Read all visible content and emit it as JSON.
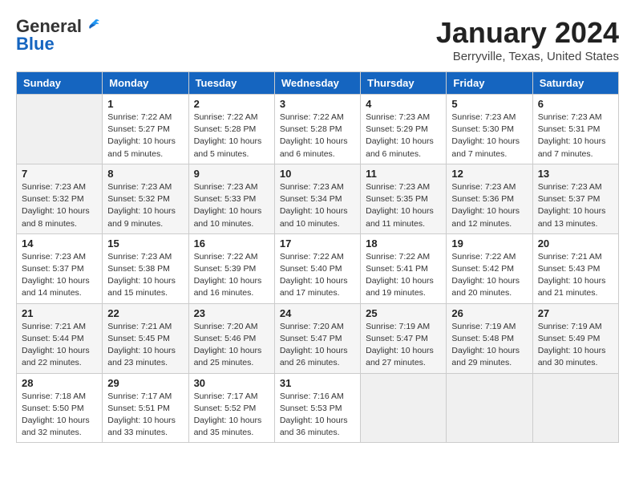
{
  "header": {
    "logo_line1": "General",
    "logo_line2": "Blue",
    "title": "January 2024",
    "subtitle": "Berryville, Texas, United States"
  },
  "weekdays": [
    "Sunday",
    "Monday",
    "Tuesday",
    "Wednesday",
    "Thursday",
    "Friday",
    "Saturday"
  ],
  "weeks": [
    [
      {
        "day": "",
        "info": ""
      },
      {
        "day": "1",
        "info": "Sunrise: 7:22 AM\nSunset: 5:27 PM\nDaylight: 10 hours\nand 5 minutes."
      },
      {
        "day": "2",
        "info": "Sunrise: 7:22 AM\nSunset: 5:28 PM\nDaylight: 10 hours\nand 5 minutes."
      },
      {
        "day": "3",
        "info": "Sunrise: 7:22 AM\nSunset: 5:28 PM\nDaylight: 10 hours\nand 6 minutes."
      },
      {
        "day": "4",
        "info": "Sunrise: 7:23 AM\nSunset: 5:29 PM\nDaylight: 10 hours\nand 6 minutes."
      },
      {
        "day": "5",
        "info": "Sunrise: 7:23 AM\nSunset: 5:30 PM\nDaylight: 10 hours\nand 7 minutes."
      },
      {
        "day": "6",
        "info": "Sunrise: 7:23 AM\nSunset: 5:31 PM\nDaylight: 10 hours\nand 7 minutes."
      }
    ],
    [
      {
        "day": "7",
        "info": "Sunrise: 7:23 AM\nSunset: 5:32 PM\nDaylight: 10 hours\nand 8 minutes."
      },
      {
        "day": "8",
        "info": "Sunrise: 7:23 AM\nSunset: 5:32 PM\nDaylight: 10 hours\nand 9 minutes."
      },
      {
        "day": "9",
        "info": "Sunrise: 7:23 AM\nSunset: 5:33 PM\nDaylight: 10 hours\nand 10 minutes."
      },
      {
        "day": "10",
        "info": "Sunrise: 7:23 AM\nSunset: 5:34 PM\nDaylight: 10 hours\nand 10 minutes."
      },
      {
        "day": "11",
        "info": "Sunrise: 7:23 AM\nSunset: 5:35 PM\nDaylight: 10 hours\nand 11 minutes."
      },
      {
        "day": "12",
        "info": "Sunrise: 7:23 AM\nSunset: 5:36 PM\nDaylight: 10 hours\nand 12 minutes."
      },
      {
        "day": "13",
        "info": "Sunrise: 7:23 AM\nSunset: 5:37 PM\nDaylight: 10 hours\nand 13 minutes."
      }
    ],
    [
      {
        "day": "14",
        "info": "Sunrise: 7:23 AM\nSunset: 5:37 PM\nDaylight: 10 hours\nand 14 minutes."
      },
      {
        "day": "15",
        "info": "Sunrise: 7:23 AM\nSunset: 5:38 PM\nDaylight: 10 hours\nand 15 minutes."
      },
      {
        "day": "16",
        "info": "Sunrise: 7:22 AM\nSunset: 5:39 PM\nDaylight: 10 hours\nand 16 minutes."
      },
      {
        "day": "17",
        "info": "Sunrise: 7:22 AM\nSunset: 5:40 PM\nDaylight: 10 hours\nand 17 minutes."
      },
      {
        "day": "18",
        "info": "Sunrise: 7:22 AM\nSunset: 5:41 PM\nDaylight: 10 hours\nand 19 minutes."
      },
      {
        "day": "19",
        "info": "Sunrise: 7:22 AM\nSunset: 5:42 PM\nDaylight: 10 hours\nand 20 minutes."
      },
      {
        "day": "20",
        "info": "Sunrise: 7:21 AM\nSunset: 5:43 PM\nDaylight: 10 hours\nand 21 minutes."
      }
    ],
    [
      {
        "day": "21",
        "info": "Sunrise: 7:21 AM\nSunset: 5:44 PM\nDaylight: 10 hours\nand 22 minutes."
      },
      {
        "day": "22",
        "info": "Sunrise: 7:21 AM\nSunset: 5:45 PM\nDaylight: 10 hours\nand 23 minutes."
      },
      {
        "day": "23",
        "info": "Sunrise: 7:20 AM\nSunset: 5:46 PM\nDaylight: 10 hours\nand 25 minutes."
      },
      {
        "day": "24",
        "info": "Sunrise: 7:20 AM\nSunset: 5:47 PM\nDaylight: 10 hours\nand 26 minutes."
      },
      {
        "day": "25",
        "info": "Sunrise: 7:19 AM\nSunset: 5:47 PM\nDaylight: 10 hours\nand 27 minutes."
      },
      {
        "day": "26",
        "info": "Sunrise: 7:19 AM\nSunset: 5:48 PM\nDaylight: 10 hours\nand 29 minutes."
      },
      {
        "day": "27",
        "info": "Sunrise: 7:19 AM\nSunset: 5:49 PM\nDaylight: 10 hours\nand 30 minutes."
      }
    ],
    [
      {
        "day": "28",
        "info": "Sunrise: 7:18 AM\nSunset: 5:50 PM\nDaylight: 10 hours\nand 32 minutes."
      },
      {
        "day": "29",
        "info": "Sunrise: 7:17 AM\nSunset: 5:51 PM\nDaylight: 10 hours\nand 33 minutes."
      },
      {
        "day": "30",
        "info": "Sunrise: 7:17 AM\nSunset: 5:52 PM\nDaylight: 10 hours\nand 35 minutes."
      },
      {
        "day": "31",
        "info": "Sunrise: 7:16 AM\nSunset: 5:53 PM\nDaylight: 10 hours\nand 36 minutes."
      },
      {
        "day": "",
        "info": ""
      },
      {
        "day": "",
        "info": ""
      },
      {
        "day": "",
        "info": ""
      }
    ]
  ]
}
